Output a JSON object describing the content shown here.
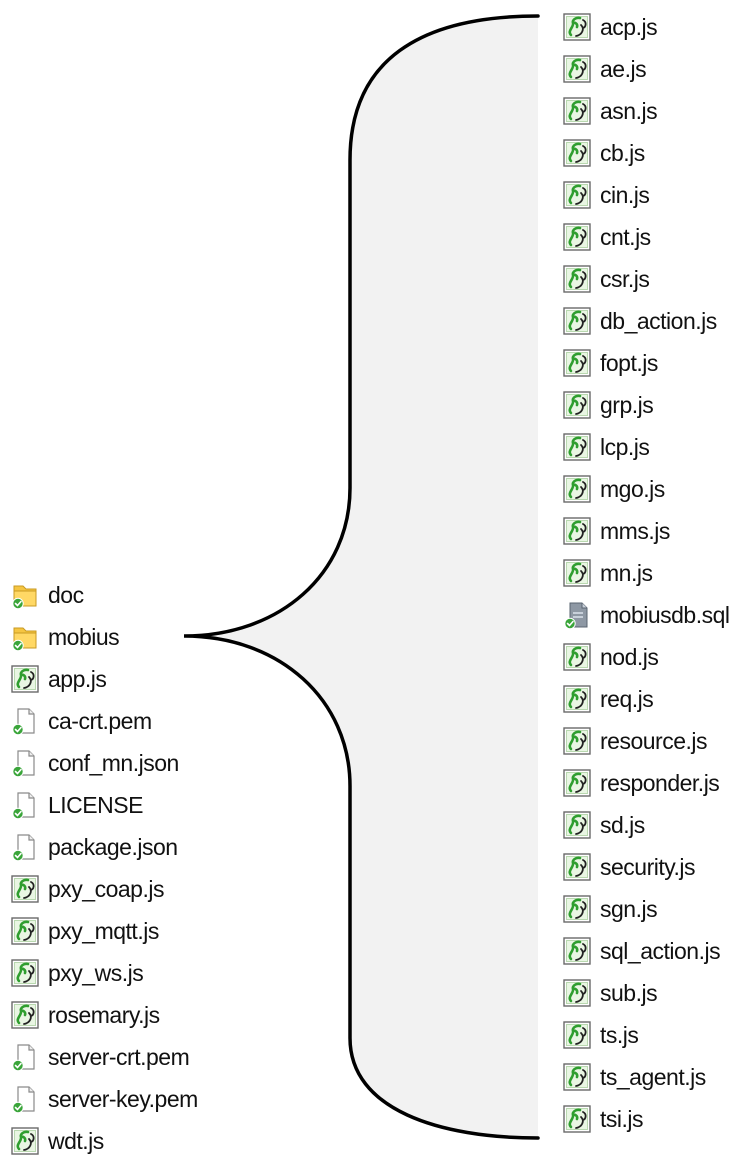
{
  "left_files": [
    {
      "name": "doc",
      "icon": "folder-icon"
    },
    {
      "name": "mobius",
      "icon": "folder-icon"
    },
    {
      "name": "app.js",
      "icon": "script-icon"
    },
    {
      "name": "ca-crt.pem",
      "icon": "file-icon"
    },
    {
      "name": "conf_mn.json",
      "icon": "file-icon"
    },
    {
      "name": "LICENSE",
      "icon": "file-icon"
    },
    {
      "name": "package.json",
      "icon": "file-icon"
    },
    {
      "name": "pxy_coap.js",
      "icon": "script-icon"
    },
    {
      "name": "pxy_mqtt.js",
      "icon": "script-icon"
    },
    {
      "name": "pxy_ws.js",
      "icon": "script-icon"
    },
    {
      "name": "rosemary.js",
      "icon": "script-icon"
    },
    {
      "name": "server-crt.pem",
      "icon": "file-icon"
    },
    {
      "name": "server-key.pem",
      "icon": "file-icon"
    },
    {
      "name": "wdt.js",
      "icon": "script-icon"
    }
  ],
  "right_files": [
    {
      "name": "acp.js",
      "icon": "script-icon"
    },
    {
      "name": "ae.js",
      "icon": "script-icon"
    },
    {
      "name": "asn.js",
      "icon": "script-icon"
    },
    {
      "name": "cb.js",
      "icon": "script-icon"
    },
    {
      "name": "cin.js",
      "icon": "script-icon"
    },
    {
      "name": "cnt.js",
      "icon": "script-icon"
    },
    {
      "name": "csr.js",
      "icon": "script-icon"
    },
    {
      "name": "db_action.js",
      "icon": "script-icon"
    },
    {
      "name": "fopt.js",
      "icon": "script-icon"
    },
    {
      "name": "grp.js",
      "icon": "script-icon"
    },
    {
      "name": "lcp.js",
      "icon": "script-icon"
    },
    {
      "name": "mgo.js",
      "icon": "script-icon"
    },
    {
      "name": "mms.js",
      "icon": "script-icon"
    },
    {
      "name": "mn.js",
      "icon": "script-icon"
    },
    {
      "name": "mobiusdb.sql",
      "icon": "sql-file-icon"
    },
    {
      "name": "nod.js",
      "icon": "script-icon"
    },
    {
      "name": "req.js",
      "icon": "script-icon"
    },
    {
      "name": "resource.js",
      "icon": "script-icon"
    },
    {
      "name": "responder.js",
      "icon": "script-icon"
    },
    {
      "name": "sd.js",
      "icon": "script-icon"
    },
    {
      "name": "security.js",
      "icon": "script-icon"
    },
    {
      "name": "sgn.js",
      "icon": "script-icon"
    },
    {
      "name": "sql_action.js",
      "icon": "script-icon"
    },
    {
      "name": "sub.js",
      "icon": "script-icon"
    },
    {
      "name": "ts.js",
      "icon": "script-icon"
    },
    {
      "name": "ts_agent.js",
      "icon": "script-icon"
    },
    {
      "name": "tsi.js",
      "icon": "script-icon"
    }
  ],
  "colors": {
    "brace_fill": "#f2f2f2",
    "brace_stroke": "#000000",
    "script_icon": "#2f9e2f",
    "folder": "#f5c542",
    "check_badge": "#3aa53a",
    "globe_badge": "#3d7fd6"
  }
}
